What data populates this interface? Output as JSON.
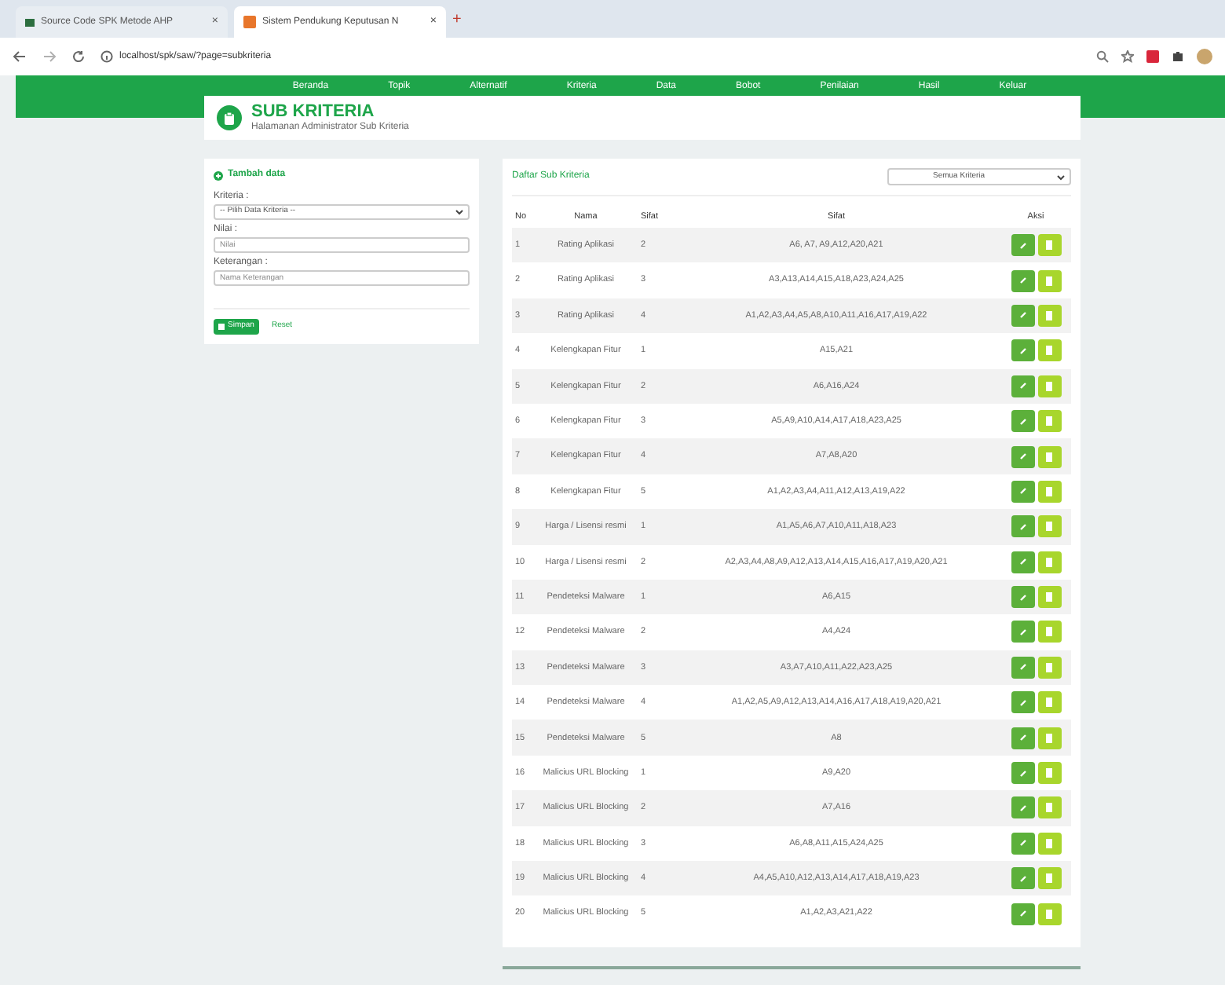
{
  "browser": {
    "tabs": [
      {
        "title": "Source Code SPK Metode AHP",
        "selected": false,
        "close": "×"
      },
      {
        "title": "Sistem Pendukung Keputusan N",
        "selected": true,
        "close": "×"
      }
    ],
    "new_tab": "+",
    "address": "localhost/spk/saw/?page=subkriteria"
  },
  "nav": [
    "Beranda",
    "Topik",
    "Alternatif",
    "Kriteria",
    "Data",
    "Bobot",
    "Penilaian",
    "Hasil",
    "Keluar"
  ],
  "page_header": {
    "title": "SUB KRITERIA",
    "subtitle": "Halamanan Administrator Sub Kriteria"
  },
  "form": {
    "title": "Tambah data",
    "fields": [
      {
        "kind": "select",
        "label": "Kriteria :",
        "value": "-- Pilih Data Kriteria --"
      },
      {
        "kind": "input",
        "label": "Nilai :",
        "placeholder": "Nilai"
      },
      {
        "kind": "input",
        "label": "Keterangan :",
        "placeholder": "Nama Keterangan"
      }
    ],
    "save_button": "Simpan",
    "reset_link": "Reset"
  },
  "table_panel": {
    "title": "Daftar Sub Kriteria",
    "filter": "Semua Kriteria",
    "columns": [
      "No",
      "Nama",
      "Sifat",
      "Sifat",
      "Aksi"
    ],
    "rows": [
      [
        "1",
        "Rating Aplikasi",
        "2",
        "A6, A7, A9,A12,A20,A21"
      ],
      [
        "2",
        "Rating Aplikasi",
        "3",
        "A3,A13,A14,A15,A18,A23,A24,A25"
      ],
      [
        "3",
        "Rating Aplikasi",
        "4",
        "A1,A2,A3,A4,A5,A8,A10,A11,A16,A17,A19,A22"
      ],
      [
        "4",
        "Kelengkapan Fitur",
        "1",
        "A15,A21"
      ],
      [
        "5",
        "Kelengkapan Fitur",
        "2",
        "A6,A16,A24"
      ],
      [
        "6",
        "Kelengkapan Fitur",
        "3",
        "A5,A9,A10,A14,A17,A18,A23,A25"
      ],
      [
        "7",
        "Kelengkapan Fitur",
        "4",
        "A7,A8,A20"
      ],
      [
        "8",
        "Kelengkapan Fitur",
        "5",
        "A1,A2,A3,A4,A11,A12,A13,A19,A22"
      ],
      [
        "9",
        "Harga / Lisensi resmi",
        "1",
        "A1,A5,A6,A7,A10,A11,A18,A23"
      ],
      [
        "10",
        "Harga / Lisensi resmi",
        "2",
        "A2,A3,A4,A8,A9,A12,A13,A14,A15,A16,A17,A19,A20,A21"
      ],
      [
        "11",
        "Pendeteksi Malware",
        "1",
        "A6,A15"
      ],
      [
        "12",
        "Pendeteksi Malware",
        "2",
        "A4,A24"
      ],
      [
        "13",
        "Pendeteksi Malware",
        "3",
        "A3,A7,A10,A11,A22,A23,A25"
      ],
      [
        "14",
        "Pendeteksi Malware",
        "4",
        "A1,A2,A5,A9,A12,A13,A14,A16,A17,A18,A19,A20,A21"
      ],
      [
        "15",
        "Pendeteksi Malware",
        "5",
        "A8"
      ],
      [
        "16",
        "Malicius URL Blocking",
        "1",
        "A9,A20"
      ],
      [
        "17",
        "Malicius URL Blocking",
        "2",
        "A7,A16"
      ],
      [
        "18",
        "Malicius URL Blocking",
        "3",
        "A6,A8,A11,A15,A24,A25"
      ],
      [
        "19",
        "Malicius URL Blocking",
        "4",
        "A4,A5,A10,A12,A13,A14,A17,A18,A19,A23"
      ],
      [
        "20",
        "Malicius URL Blocking",
        "5",
        "A1,A2,A3,A21,A22"
      ]
    ]
  }
}
